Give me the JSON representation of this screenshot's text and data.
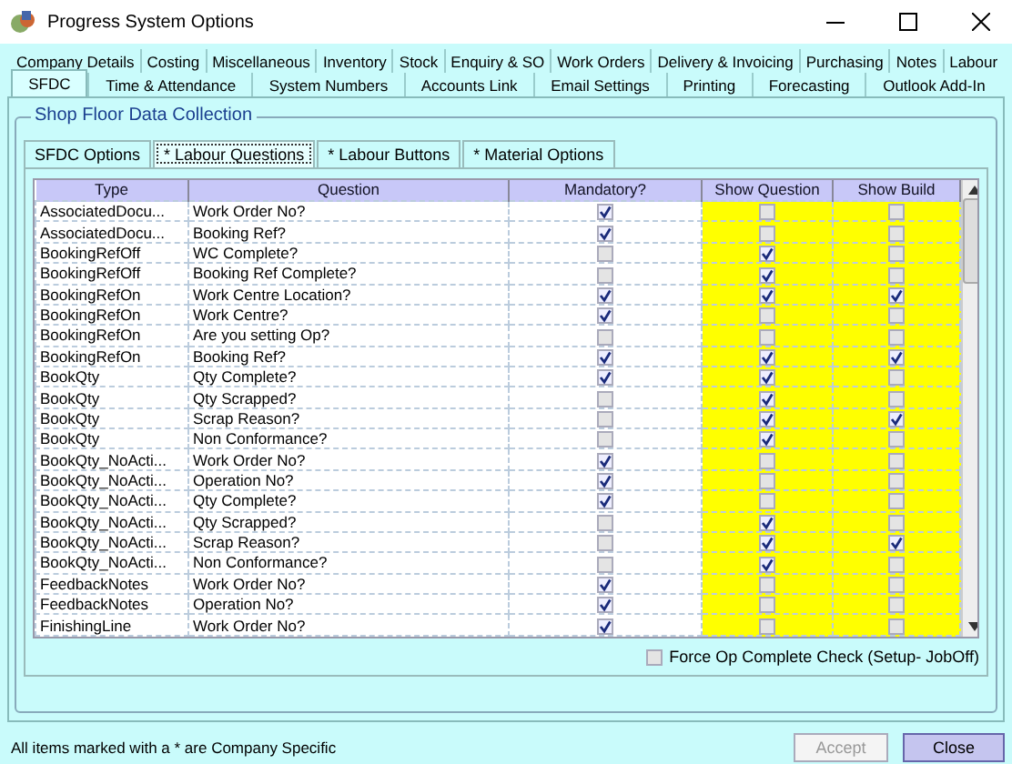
{
  "window": {
    "title": "Progress System Options"
  },
  "tab_rows": [
    [
      {
        "label": "Company Details",
        "selected": false
      },
      {
        "label": "Costing",
        "selected": false
      },
      {
        "label": "Miscellaneous",
        "selected": false
      },
      {
        "label": "Inventory",
        "selected": false
      },
      {
        "label": "Stock",
        "selected": false
      },
      {
        "label": "Enquiry & SO",
        "selected": false
      },
      {
        "label": "Work Orders",
        "selected": false
      },
      {
        "label": "Delivery & Invoicing",
        "selected": false
      },
      {
        "label": "Purchasing",
        "selected": false
      },
      {
        "label": "Notes",
        "selected": false
      },
      {
        "label": "Labour",
        "selected": false
      }
    ],
    [
      {
        "label": "SFDC",
        "selected": true
      },
      {
        "label": "Time & Attendance",
        "selected": false
      },
      {
        "label": "System Numbers",
        "selected": false
      },
      {
        "label": "Accounts Link",
        "selected": false
      },
      {
        "label": "Email Settings",
        "selected": false
      },
      {
        "label": "Printing",
        "selected": false
      },
      {
        "label": "Forecasting",
        "selected": false
      },
      {
        "label": "Outlook Add-In",
        "selected": false
      }
    ]
  ],
  "group": {
    "title": "Shop Floor Data Collection"
  },
  "sub_tabs": [
    {
      "label": "SFDC Options",
      "selected": false
    },
    {
      "label": "* Labour Questions",
      "selected": true
    },
    {
      "label": "* Labour Buttons",
      "selected": false
    },
    {
      "label": "* Material Options",
      "selected": false
    }
  ],
  "table": {
    "columns": [
      "Type",
      "Question",
      "Mandatory?",
      "Show Question",
      "Show Build"
    ],
    "rows": [
      {
        "type": "AssociatedDocu...",
        "question": "Work Order No?",
        "mandatory": true,
        "show_question": false,
        "show_build": false
      },
      {
        "type": "AssociatedDocu...",
        "question": "Booking Ref?",
        "mandatory": true,
        "show_question": false,
        "show_build": false
      },
      {
        "type": "BookingRefOff",
        "question": "WC Complete?",
        "mandatory": false,
        "show_question": true,
        "show_build": false
      },
      {
        "type": "BookingRefOff",
        "question": "Booking Ref Complete?",
        "mandatory": false,
        "show_question": true,
        "show_build": false
      },
      {
        "type": "BookingRefOn",
        "question": "Work Centre Location?",
        "mandatory": true,
        "show_question": true,
        "show_build": true
      },
      {
        "type": "BookingRefOn",
        "question": "Work Centre?",
        "mandatory": true,
        "show_question": false,
        "show_build": false
      },
      {
        "type": "BookingRefOn",
        "question": "Are you setting Op?",
        "mandatory": false,
        "show_question": false,
        "show_build": false
      },
      {
        "type": "BookingRefOn",
        "question": "Booking Ref?",
        "mandatory": true,
        "show_question": true,
        "show_build": true
      },
      {
        "type": "BookQty",
        "question": "Qty Complete?",
        "mandatory": true,
        "show_question": true,
        "show_build": false
      },
      {
        "type": "BookQty",
        "question": "Qty Scrapped?",
        "mandatory": false,
        "show_question": true,
        "show_build": false
      },
      {
        "type": "BookQty",
        "question": "Scrap Reason?",
        "mandatory": false,
        "show_question": true,
        "show_build": true
      },
      {
        "type": "BookQty",
        "question": "Non Conformance?",
        "mandatory": false,
        "show_question": true,
        "show_build": false
      },
      {
        "type": "BookQty_NoActi...",
        "question": "Work Order No?",
        "mandatory": true,
        "show_question": false,
        "show_build": false
      },
      {
        "type": "BookQty_NoActi...",
        "question": "Operation No?",
        "mandatory": true,
        "show_question": false,
        "show_build": false
      },
      {
        "type": "BookQty_NoActi...",
        "question": "Qty Complete?",
        "mandatory": true,
        "show_question": false,
        "show_build": false
      },
      {
        "type": "BookQty_NoActi...",
        "question": "Qty Scrapped?",
        "mandatory": false,
        "show_question": true,
        "show_build": false
      },
      {
        "type": "BookQty_NoActi...",
        "question": "Scrap Reason?",
        "mandatory": false,
        "show_question": true,
        "show_build": true
      },
      {
        "type": "BookQty_NoActi...",
        "question": "Non Conformance?",
        "mandatory": false,
        "show_question": true,
        "show_build": false
      },
      {
        "type": "FeedbackNotes",
        "question": "Work Order No?",
        "mandatory": true,
        "show_question": false,
        "show_build": false
      },
      {
        "type": "FeedbackNotes",
        "question": "Operation No?",
        "mandatory": true,
        "show_question": false,
        "show_build": false
      },
      {
        "type": "FinishingLine",
        "question": "Work Order No?",
        "mandatory": true,
        "show_question": false,
        "show_build": false
      }
    ]
  },
  "force_check": {
    "label": "Force Op Complete Check (Setup- JobOff)",
    "checked": false
  },
  "footer_note": "All items marked with a * are Company Specific",
  "buttons": [
    {
      "label": "Accept",
      "disabled": true
    },
    {
      "label": "Close",
      "disabled": false
    }
  ]
}
